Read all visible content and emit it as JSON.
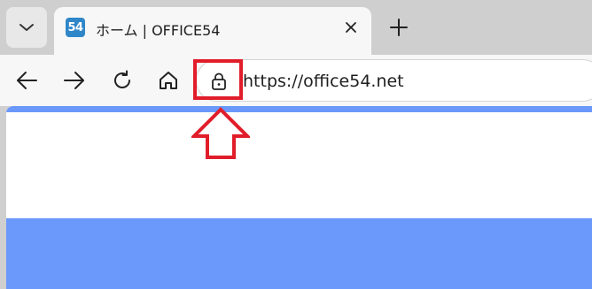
{
  "browser": {
    "tab_menu_icon": "chevron-down-icon",
    "tab": {
      "favicon_text": "54",
      "title": "ホーム | OFFICE54",
      "close_icon": "close-icon"
    },
    "new_tab_icon": "plus-icon",
    "toolbar": {
      "back_icon": "arrow-left-icon",
      "forward_icon": "arrow-right-icon",
      "reload_icon": "reload-icon",
      "home_icon": "home-icon",
      "site_info_icon": "lock-icon",
      "url": "https://office54.net"
    }
  },
  "annotation": {
    "highlight_color": "#e11d2a",
    "arrow_icon": "up-arrow-outline-icon"
  },
  "colors": {
    "accent_blue": "#6b98fb",
    "favicon_blue": "#2f86c8"
  }
}
